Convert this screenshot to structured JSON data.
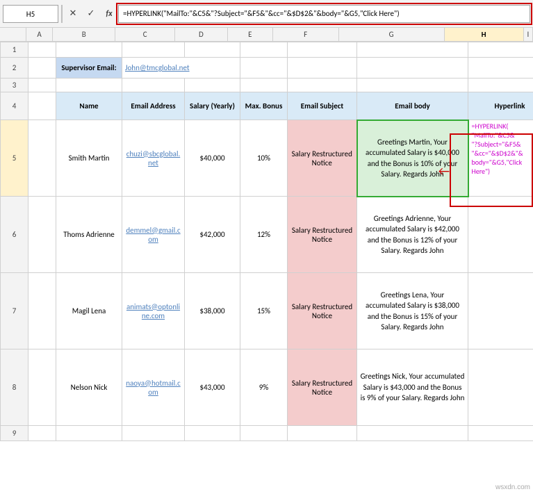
{
  "formula_bar": {
    "name_box_value": "H5",
    "formula_content": "=HYPERLINK(\"MailTo:\"&C5&\"?Subject=\"&F5&\"&cc=\"&$D$2&\"&body=\"&G5,\"Click Here\")",
    "cancel_icon": "✕",
    "confirm_icon": "✓",
    "fx_label": "fx"
  },
  "column_headers": [
    "A",
    "B",
    "C",
    "D",
    "E",
    "F",
    "G",
    "H",
    "I"
  ],
  "row_numbers": [
    "1",
    "2",
    "3",
    "4",
    "5",
    "6",
    "7",
    "8",
    "9"
  ],
  "supervisor": {
    "label": "Supervisor Email:",
    "email": "John@tmcglobal.net"
  },
  "table_headers": {
    "name": "Name",
    "email_address": "Email Address",
    "salary_yearly": "Salary (Yearly)",
    "max_bonus": "Max. Bonus",
    "email_subject": "Email Subject",
    "email_body": "Email body",
    "hyperlink": "Hyperlink"
  },
  "rows": [
    {
      "name": "Smith Martin",
      "email": "chuzi@sbcglobal.net",
      "salary": "$40,000",
      "bonus": "10%",
      "subject": "Salary Restructured Notice",
      "body": "Greetings Martin, Your accumulated Salary is $40,000 and the Bonus is 10% of your Salary. Regards John",
      "hyperlink": "=HYPERLINK(“MailTo:”&C5&“?Subject=”&F5&“&cc=”&$D$2&“&body=”&G5,“Click Here”)"
    },
    {
      "name": "Thoms Adrienne",
      "email": "demmel@gmail.com",
      "salary": "$42,000",
      "bonus": "12%",
      "subject": "Salary Restructured Notice",
      "body": "Greetings Adrienne, Your accumulated Salary is $42,000 and the Bonus is 12% of your Salary. Regards John",
      "hyperlink": ""
    },
    {
      "name": "Magil Lena",
      "email": "animats@optonline.com",
      "salary": "$38,000",
      "bonus": "15%",
      "subject": "Salary Restructured Notice",
      "body": "Greetings Lena, Your accumulated Salary is $38,000 and the Bonus is 15% of your Salary. Regards John",
      "hyperlink": ""
    },
    {
      "name": "Nelson Nick",
      "email": "naoya@hotmail.com",
      "salary": "$43,000",
      "bonus": "9%",
      "subject": "Salary Restructured Notice",
      "body": "Greetings Nick, Your accumulated Salary is $43,000 and the Bonus is 9% of your Salary. Regards John",
      "hyperlink": ""
    }
  ],
  "annotation": {
    "hyperlink_text": "=HYPERLINK(“MailTo:”&C5&“?Subject=”&F5&“&cc=”&$D$2&“&body=”&G5,“Click Here”)"
  },
  "wsxdn": "wsxdn.com"
}
